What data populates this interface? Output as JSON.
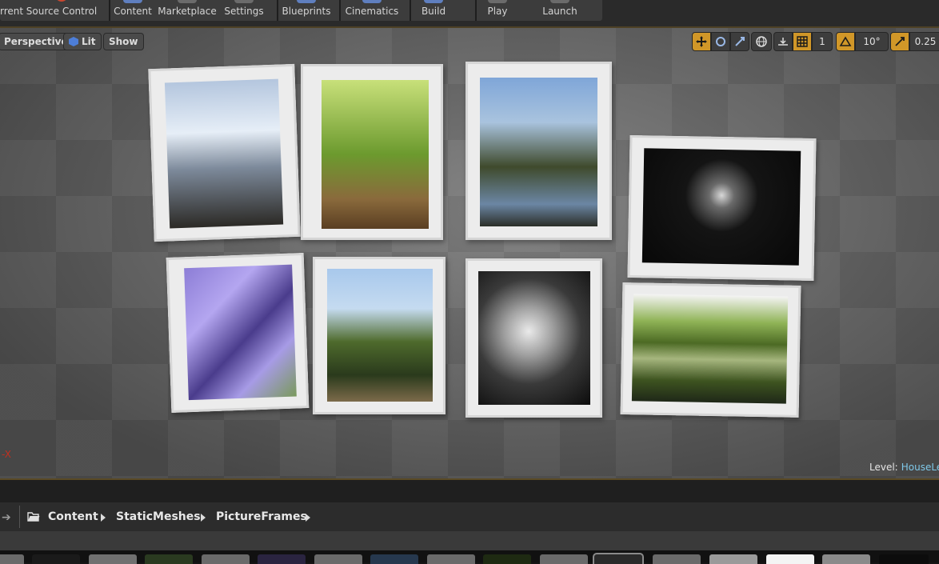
{
  "toolbar": {
    "buttons": [
      {
        "label": "rrent"
      },
      {
        "label": "Source Control"
      },
      {
        "label": "Content"
      },
      {
        "label": "Marketplace"
      },
      {
        "label": "Settings"
      },
      {
        "label": "Blueprints"
      },
      {
        "label": "Cinematics"
      },
      {
        "label": "Build"
      },
      {
        "label": "Play"
      },
      {
        "label": "Launch"
      }
    ]
  },
  "viewport": {
    "perspective_label": "Perspective",
    "lit_label": "Lit",
    "show_label": "Show",
    "grid_snap_value": "1",
    "rotation_snap_value": "10°",
    "scale_snap_value": "0.25",
    "axis_label": "-X",
    "level_prefix": "Level:",
    "level_name": "HouseLev"
  },
  "content_browser": {
    "breadcrumb": [
      "Content",
      "StaticMeshes",
      "PictureFrames"
    ]
  },
  "colors": {
    "accent": "#d19728",
    "level_link": "#7fc9ea",
    "axis_x": "#c03020"
  }
}
